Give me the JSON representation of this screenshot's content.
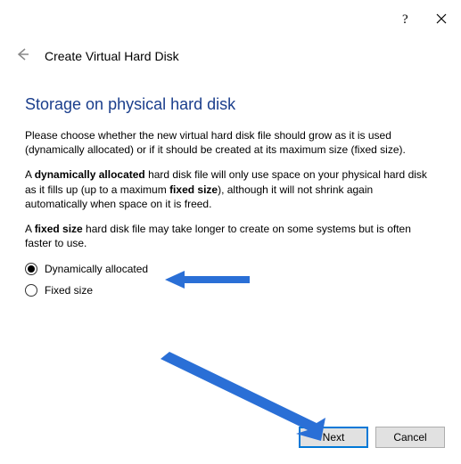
{
  "header": {
    "title": "Create Virtual Hard Disk"
  },
  "heading": "Storage on physical hard disk",
  "paragraph1_a": "Please choose whether the new virtual hard disk file should grow as it is used (dynamically allocated) or if it should be created at its maximum size (fixed size).",
  "paragraph2_pre": "A ",
  "paragraph2_b1": "dynamically allocated",
  "paragraph2_mid": " hard disk file will only use space on your physical hard disk as it fills up (up to a maximum ",
  "paragraph2_b2": "fixed size",
  "paragraph2_post": "), although it will not shrink again automatically when space on it is freed.",
  "paragraph3_pre": "A ",
  "paragraph3_b1": "fixed size",
  "paragraph3_post": " hard disk file may take longer to create on some systems but is often faster to use.",
  "options": {
    "dynamic": "Dynamically allocated",
    "fixed": "Fixed size"
  },
  "footer": {
    "next": "Next",
    "cancel": "Cancel"
  }
}
